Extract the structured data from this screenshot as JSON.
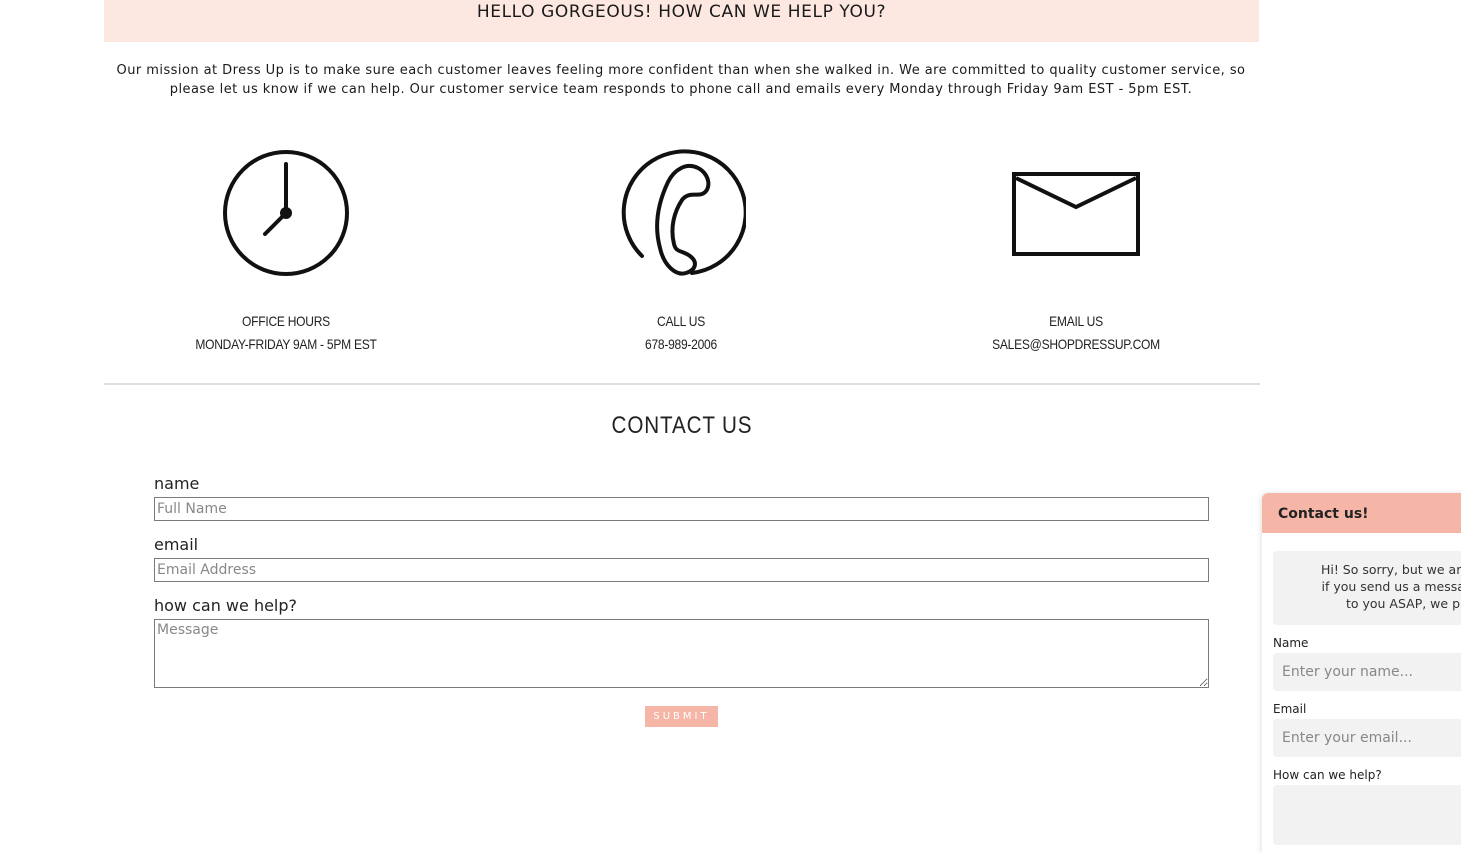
{
  "banner": {
    "text": "HELLO GORGEOUS! HOW CAN WE HELP YOU?"
  },
  "mission": {
    "line1": "Our mission at Dress Up is to make sure each customer leaves feeling more confident than when she walked in. We are committed to quality customer service, so",
    "line2": "please let us know if we can help. Our customer service team responds to phone call and emails every Monday through Friday 9am EST - 5pm EST."
  },
  "info": [
    {
      "icon": "clock-icon",
      "title": "OFFICE HOURS",
      "detail": "MONDAY-FRIDAY 9AM - 5PM EST"
    },
    {
      "icon": "phone-icon",
      "title": "CALL US",
      "detail": "678-989-2006"
    },
    {
      "icon": "envelope-icon",
      "title": "EMAIL US",
      "detail": "SALES@SHOPDRESSUP.COM"
    }
  ],
  "form": {
    "title": "CONTACT US",
    "name_label": "name",
    "name_placeholder": "Full Name",
    "email_label": "email",
    "email_placeholder": "Email Address",
    "help_label": "how can we help?",
    "message_placeholder": "Message",
    "submit_label": "SUBMIT"
  },
  "widget": {
    "title": "Contact us!",
    "message_line1": "Hi! So sorry, but we aren't",
    "message_line2": "if you send us a message,",
    "message_line3": "to you ASAP, we p",
    "name_label": "Name",
    "name_placeholder": "Enter your name...",
    "email_label": "Email",
    "email_placeholder": "Enter your email...",
    "help_label": "How can we help?"
  },
  "colors": {
    "banner_bg": "#fce8e1",
    "accent": "#f6b6a7",
    "field_bg": "#f2f2f2"
  }
}
